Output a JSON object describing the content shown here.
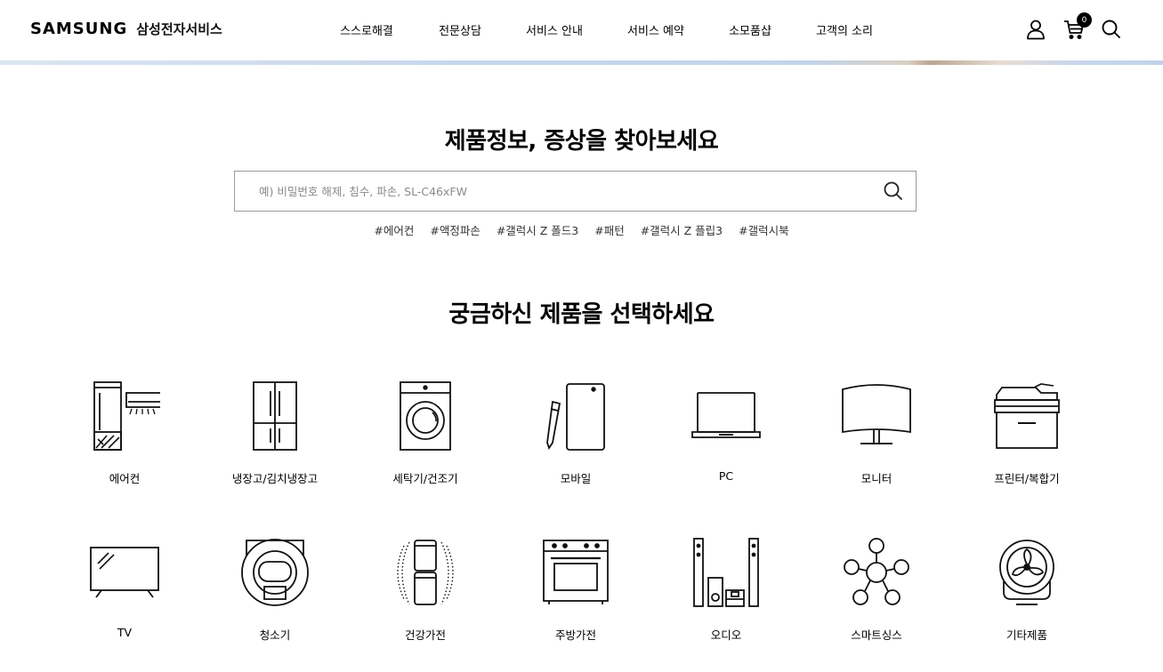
{
  "header": {
    "logo_brand": "SAMSUNG",
    "logo_sub": "삼성전자서비스",
    "nav": [
      "스스로해결",
      "전문상담",
      "서비스 안내",
      "서비스 예약",
      "소모품샵",
      "고객의 소리"
    ],
    "cart_count": "0",
    "icons": [
      "user-icon",
      "cart-icon",
      "search-icon"
    ]
  },
  "search": {
    "title": "제품정보, 증상을 찾아보세요",
    "placeholder": "예) 비밀번호 해제, 침수, 파손, SL-C46xFW",
    "value": "",
    "tags": [
      "#에어컨",
      "#액정파손",
      "#갤럭시 Z 폴드3",
      "#패턴",
      "#갤럭시 Z 플립3",
      "#갤럭시북"
    ]
  },
  "products": {
    "title": "궁금하신 제품을 선택하세요",
    "items": [
      {
        "label": "에어컨",
        "icon": "air-conditioner-icon"
      },
      {
        "label": "냉장고/김치냉장고",
        "icon": "refrigerator-icon"
      },
      {
        "label": "세탁기/건조기",
        "icon": "washing-machine-icon"
      },
      {
        "label": "모바일",
        "icon": "mobile-icon"
      },
      {
        "label": "PC",
        "icon": "laptop-icon"
      },
      {
        "label": "모니터",
        "icon": "monitor-icon"
      },
      {
        "label": "프린터/복합기",
        "icon": "printer-icon"
      },
      {
        "label": "TV",
        "icon": "tv-icon"
      },
      {
        "label": "청소기",
        "icon": "robot-vacuum-icon"
      },
      {
        "label": "건강가전",
        "icon": "air-purifier-icon"
      },
      {
        "label": "주방가전",
        "icon": "oven-icon"
      },
      {
        "label": "오디오",
        "icon": "audio-icon"
      },
      {
        "label": "스마트싱스",
        "icon": "smartthings-icon"
      },
      {
        "label": "기타제품",
        "icon": "fan-icon"
      }
    ]
  },
  "colors": {
    "text": "#000000",
    "border": "#9a9a9a",
    "hero_strip": "#c7d6ec"
  }
}
